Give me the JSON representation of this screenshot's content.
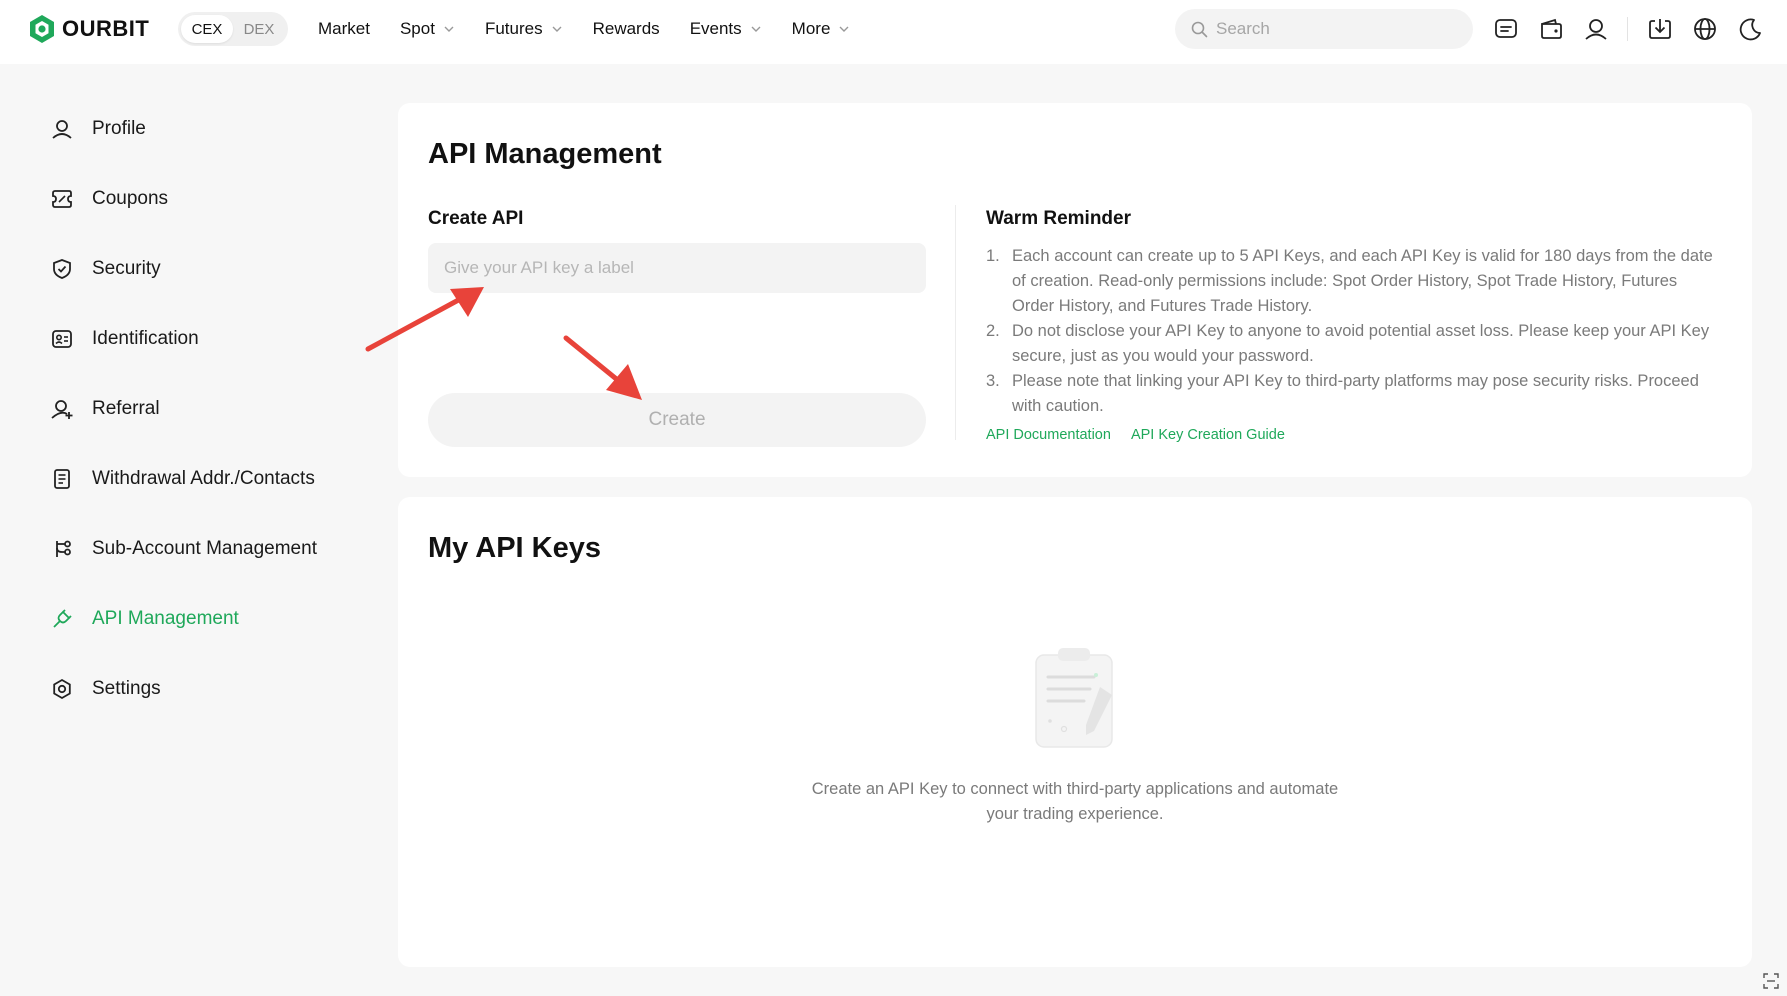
{
  "brand": {
    "name": "OURBIT",
    "accent": "#1fa85a",
    "arrow_color": "#e8433a"
  },
  "header": {
    "toggle": {
      "options": [
        "CEX",
        "DEX"
      ],
      "selected": "CEX"
    },
    "nav": [
      {
        "label": "Market",
        "dropdown": false
      },
      {
        "label": "Spot",
        "dropdown": true
      },
      {
        "label": "Futures",
        "dropdown": true
      },
      {
        "label": "Rewards",
        "dropdown": false
      },
      {
        "label": "Events",
        "dropdown": true
      },
      {
        "label": "More",
        "dropdown": true
      }
    ],
    "search": {
      "placeholder": "Search",
      "value": ""
    },
    "icons": [
      "message-icon",
      "wallet-icon",
      "user-icon",
      "download-icon",
      "globe-icon",
      "moon-icon"
    ]
  },
  "sidebar": {
    "items": [
      {
        "label": "Profile",
        "icon": "user-icon",
        "active": false
      },
      {
        "label": "Coupons",
        "icon": "coupon-icon",
        "active": false
      },
      {
        "label": "Security",
        "icon": "shield-icon",
        "active": false
      },
      {
        "label": "Identification",
        "icon": "id-card-icon",
        "active": false
      },
      {
        "label": "Referral",
        "icon": "user-plus-icon",
        "active": false
      },
      {
        "label": "Withdrawal Addr./Contacts",
        "icon": "document-icon",
        "active": false
      },
      {
        "label": "Sub-Account Management",
        "icon": "branch-icon",
        "active": false
      },
      {
        "label": "API Management",
        "icon": "api-plug-icon",
        "active": true
      },
      {
        "label": "Settings",
        "icon": "settings-icon",
        "active": false
      }
    ]
  },
  "api_card": {
    "title": "API Management",
    "create_label": "Create API",
    "input": {
      "placeholder": "Give your API key a label",
      "value": ""
    },
    "create_button": "Create",
    "reminder": {
      "title": "Warm Reminder",
      "items": [
        "Each account can create up to 5 API Keys, and each API Key is valid for 180 days from the date of creation. Read-only permissions include: Spot Order History, Spot Trade History, Futures Order History, and Futures Trade History.",
        "Do not disclose your API Key to anyone to avoid potential asset loss. Please keep your API Key secure, just as you would your password.",
        "Please note that linking your API Key to third-party platforms may pose security risks. Proceed with caution."
      ]
    },
    "links": [
      "API Documentation",
      "API Key Creation Guide"
    ]
  },
  "keys_card": {
    "title": "My API Keys",
    "empty_text": "Create an API Key to connect with third-party applications and automate your trading experience."
  }
}
